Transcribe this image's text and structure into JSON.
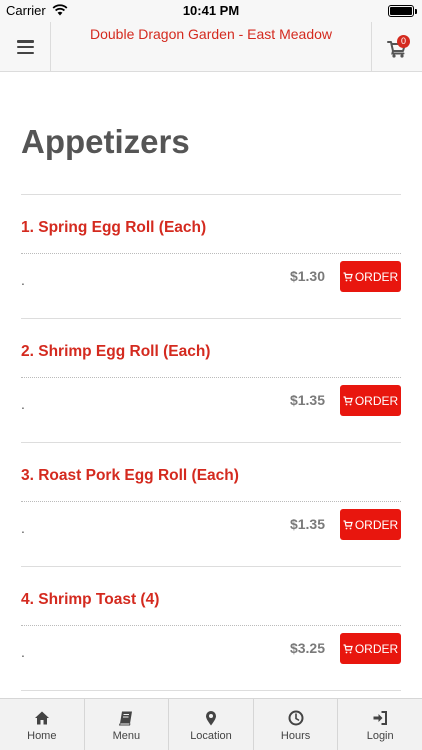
{
  "status_bar": {
    "carrier": "Carrier",
    "time": "10:41 PM"
  },
  "nav": {
    "title": "Double Dragon Garden - East Meadow",
    "cart_count": "0",
    "menu_icon": "hamburger-icon",
    "cart_icon": "cart-icon"
  },
  "section": {
    "title": "Appetizers"
  },
  "items": [
    {
      "name": "1. Spring Egg Roll (Each)",
      "description": ".",
      "price": "$1.30",
      "order_label": "ORDER"
    },
    {
      "name": "2. Shrimp Egg Roll (Each)",
      "description": ".",
      "price": "$1.35",
      "order_label": "ORDER"
    },
    {
      "name": "3. Roast Pork Egg Roll (Each)",
      "description": ".",
      "price": "$1.35",
      "order_label": "ORDER"
    },
    {
      "name": "4. Shrimp Toast (4)",
      "description": ".",
      "price": "$3.25",
      "order_label": "ORDER"
    }
  ],
  "tabs": [
    {
      "label": "Home",
      "icon": "home-icon"
    },
    {
      "label": "Menu",
      "icon": "book-icon"
    },
    {
      "label": "Location",
      "icon": "map-marker-icon"
    },
    {
      "label": "Hours",
      "icon": "clock-icon"
    },
    {
      "label": "Login",
      "icon": "login-icon"
    }
  ],
  "colors": {
    "brand_red": "#d42a1f",
    "order_button": "#e8160e"
  }
}
